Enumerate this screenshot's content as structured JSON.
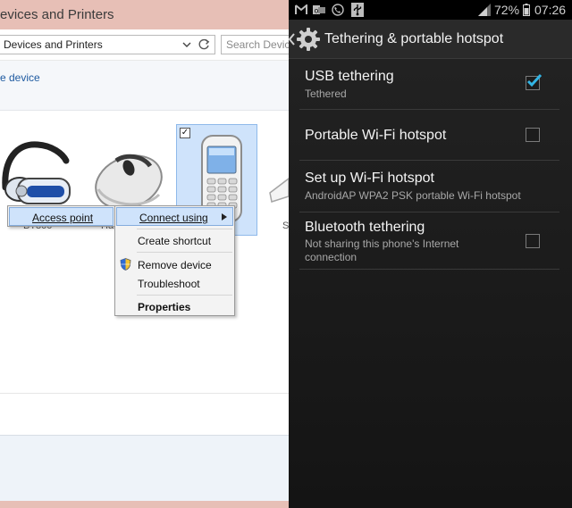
{
  "windows": {
    "title": "evices and Printers",
    "address_text": "Devices and Printers",
    "search_placeholder": "Search Devices",
    "command_link": "e device",
    "device_labels": [
      "BT800",
      "Ha",
      "S"
    ],
    "context_menu_left": {
      "items": [
        {
          "label": "Access point",
          "accel": "A"
        }
      ]
    },
    "context_menu_main": {
      "items": [
        {
          "label": "Connect using",
          "has_submenu": true
        },
        {
          "label": "Create shortcut"
        },
        {
          "label": "Remove device"
        },
        {
          "label": "Troubleshoot"
        },
        {
          "label": "Properties",
          "bold": true
        }
      ]
    }
  },
  "android": {
    "status_bar": {
      "battery": "72%",
      "time": "07:26"
    },
    "action_bar_title": "Tethering & portable hotspot",
    "settings": [
      {
        "title": "USB tethering",
        "summary": "Tethered",
        "checked": true
      },
      {
        "title": "Portable Wi-Fi hotspot",
        "summary": "",
        "checked": false
      },
      {
        "title": "Set up Wi-Fi hotspot",
        "summary": "AndroidAP WPA2 PSK portable Wi-Fi hotspot"
      },
      {
        "title": "Bluetooth tethering",
        "summary": "Not sharing this phone's Internet connection",
        "checked": false
      }
    ],
    "colors": {
      "accent": "#33b5e5",
      "background": "#1c1c1c"
    }
  },
  "colors": {
    "window_title_bar": "#e7bfb6",
    "selection": "#cfe3fb",
    "link": "#1e5aa0"
  }
}
